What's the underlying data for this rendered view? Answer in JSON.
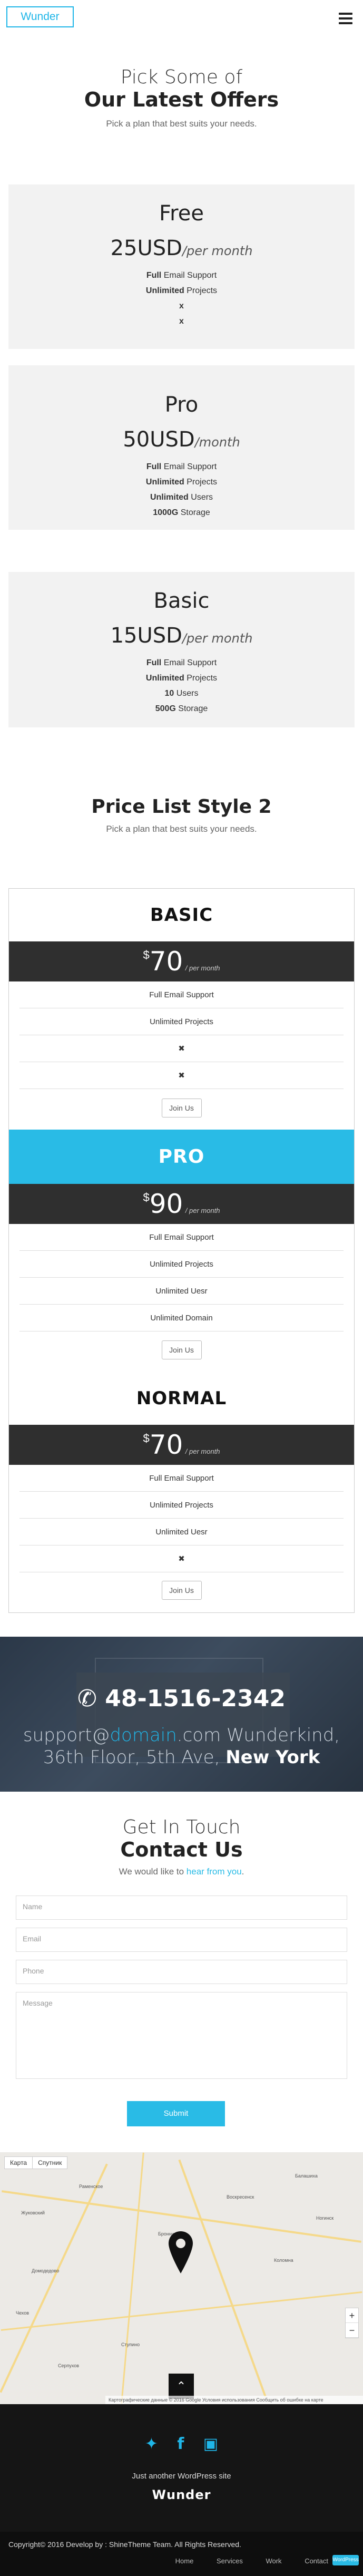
{
  "header": {
    "logo": "Wunder"
  },
  "offers": {
    "title_light": "Pick Some of",
    "title_bold": "Our Latest Offers",
    "subtitle": "Pick a plan that best suits your needs.",
    "plans": [
      {
        "name": "Free",
        "price": "25USD",
        "per": "/per month",
        "f": [
          {
            "b": "Full",
            "t": " Email Support"
          },
          {
            "b": "Unlimited",
            "t": " Projects"
          },
          {
            "b": "x",
            "t": ""
          },
          {
            "b": "x",
            "t": ""
          }
        ]
      },
      {
        "name": "Pro",
        "price": "50USD",
        "per": "/month",
        "f": [
          {
            "b": "Full",
            "t": " Email Support"
          },
          {
            "b": "Unlimited",
            "t": " Projects"
          },
          {
            "b": "Unlimited",
            "t": " Users"
          },
          {
            "b": "1000G",
            "t": " Storage"
          }
        ]
      },
      {
        "name": "Basic",
        "price": "15USD",
        "per": "/per month",
        "f": [
          {
            "b": "Full",
            "t": " Email Support"
          },
          {
            "b": "Unlimited",
            "t": " Projects"
          },
          {
            "b": "10",
            "t": " Users"
          },
          {
            "b": "500G",
            "t": " Storage"
          }
        ]
      }
    ]
  },
  "style2": {
    "title": "Price List Style 2",
    "subtitle": "Pick a plan that best suits your needs.",
    "currency": "$",
    "join": "Join Us",
    "cols": [
      {
        "name": "BASIC",
        "amount": "70",
        "per": "/ per month",
        "features": [
          "Full Email Support",
          "Unlimited Projects",
          "✖",
          "✖"
        ]
      },
      {
        "name": "PRO",
        "amount": "90",
        "per": "/ per month",
        "features": [
          "Full Email Support",
          "Unlimited Projects",
          "Unlimited Uesr",
          "Unlimited Domain"
        ]
      },
      {
        "name": "NORMAL",
        "amount": "70",
        "per": "/ per month",
        "features": [
          "Full Email Support",
          "Unlimited Projects",
          "Unlimited Uesr",
          "✖"
        ]
      }
    ]
  },
  "banner": {
    "phone": "48-1516-2342",
    "email_user": "support@",
    "email_domain": "domain",
    "email_tld": ".com",
    "address": " Wunderkind, 36th Floor, 5th Ave, ",
    "city": "New York"
  },
  "contact": {
    "title_light": "Get In Touch",
    "title_bold": "Contact Us",
    "sub_pre": "We would like to ",
    "sub_link": "hear from you",
    "sub_post": ".",
    "name_ph": "Name",
    "email_ph": "Email",
    "phone_ph": "Phone",
    "message_ph": "Message",
    "submit": "Submit"
  },
  "map": {
    "tab_map": "Карта",
    "tab_sat": "Спутник",
    "zoom_in": "+",
    "zoom_out": "−",
    "scroll_up": "⌃",
    "attribution": "Картографические данные © 2016 Google   Условия использования   Сообщить об ошибке на карте",
    "towns": [
      "Бронницы",
      "Раменское",
      "Жуковский",
      "Коломна",
      "Воскресенск",
      "Домодедово",
      "Ступино",
      "Чехов",
      "Серпухов",
      "Балашиха",
      "Ногинск"
    ]
  },
  "footer": {
    "tagline": "Just another WordPress site",
    "brand": "Wunder",
    "copyright": "Copyright© 2016 Develop by : ShineTheme Team. All Rights Reserved.",
    "nav": [
      "Home",
      "Services",
      "Work",
      "Contact"
    ],
    "badge": "WordPress"
  },
  "colors": {
    "accent": "#29bbe6",
    "dark": "#2f2f2f",
    "card": "#f2f2f2"
  }
}
